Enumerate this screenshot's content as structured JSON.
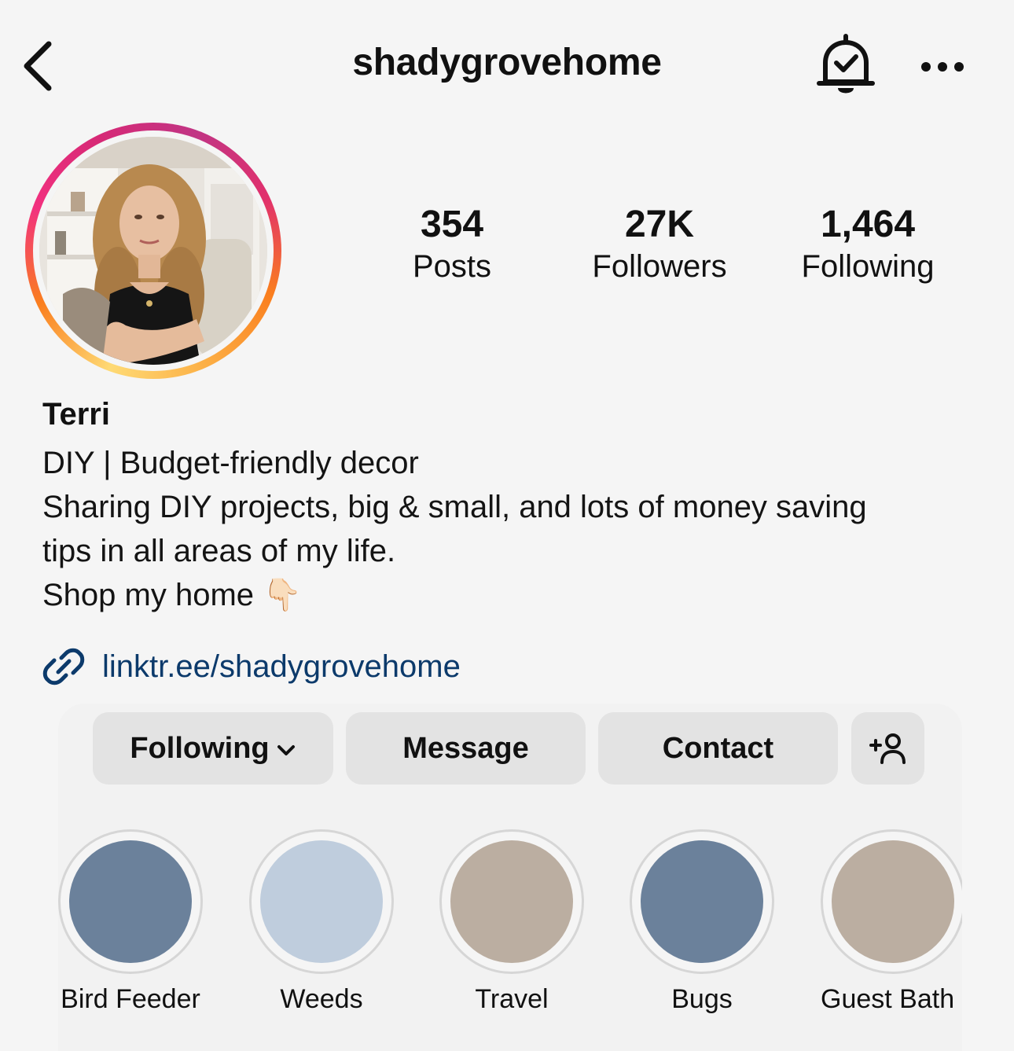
{
  "header": {
    "username": "shadygrovehome",
    "icons": [
      "back-arrow-icon",
      "notification-bell-check-icon",
      "more-options-icon"
    ]
  },
  "profile": {
    "stats": [
      {
        "value": "354",
        "label": "Posts"
      },
      {
        "value": "27K",
        "label": "Followers"
      },
      {
        "value": "1,464",
        "label": "Following"
      }
    ],
    "name": "Terri",
    "bio": [
      "DIY | Budget-friendly decor",
      "Sharing DIY projects, big & small, and lots of money saving",
      "tips in all areas of my life.",
      "Shop my home 👇🏻"
    ],
    "link": "linktr.ee/shadygrovehome"
  },
  "actions": {
    "following": "Following",
    "message": "Message",
    "contact": "Contact"
  },
  "highlights": [
    {
      "label": "Bird Feeder",
      "color": "#6b819b"
    },
    {
      "label": "Weeds",
      "color": "#bfcddd"
    },
    {
      "label": "Travel",
      "color": "#bbaea1"
    },
    {
      "label": "Bugs",
      "color": "#6b819b"
    },
    {
      "label": "Guest Bath",
      "color": "#bbaea1"
    }
  ]
}
